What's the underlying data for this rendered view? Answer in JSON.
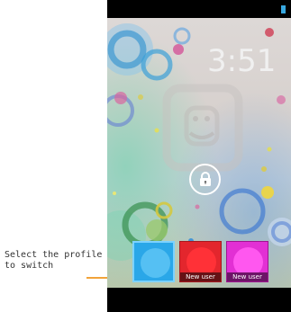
{
  "annotation": {
    "text": "Select the profile\nto switch"
  },
  "lock_screen": {
    "clock": "3:51",
    "unlock_icon": "lock-icon",
    "status_icon": "battery-icon"
  },
  "profiles": [
    {
      "label": "",
      "color": "#2aa7e8"
    },
    {
      "label": "New user",
      "color": "#e3262d"
    },
    {
      "label": "New user",
      "color": "#e230d4"
    }
  ],
  "colors": {
    "annotation_arrow": "#f2a33a",
    "clock_text": "#f0f0f0"
  }
}
